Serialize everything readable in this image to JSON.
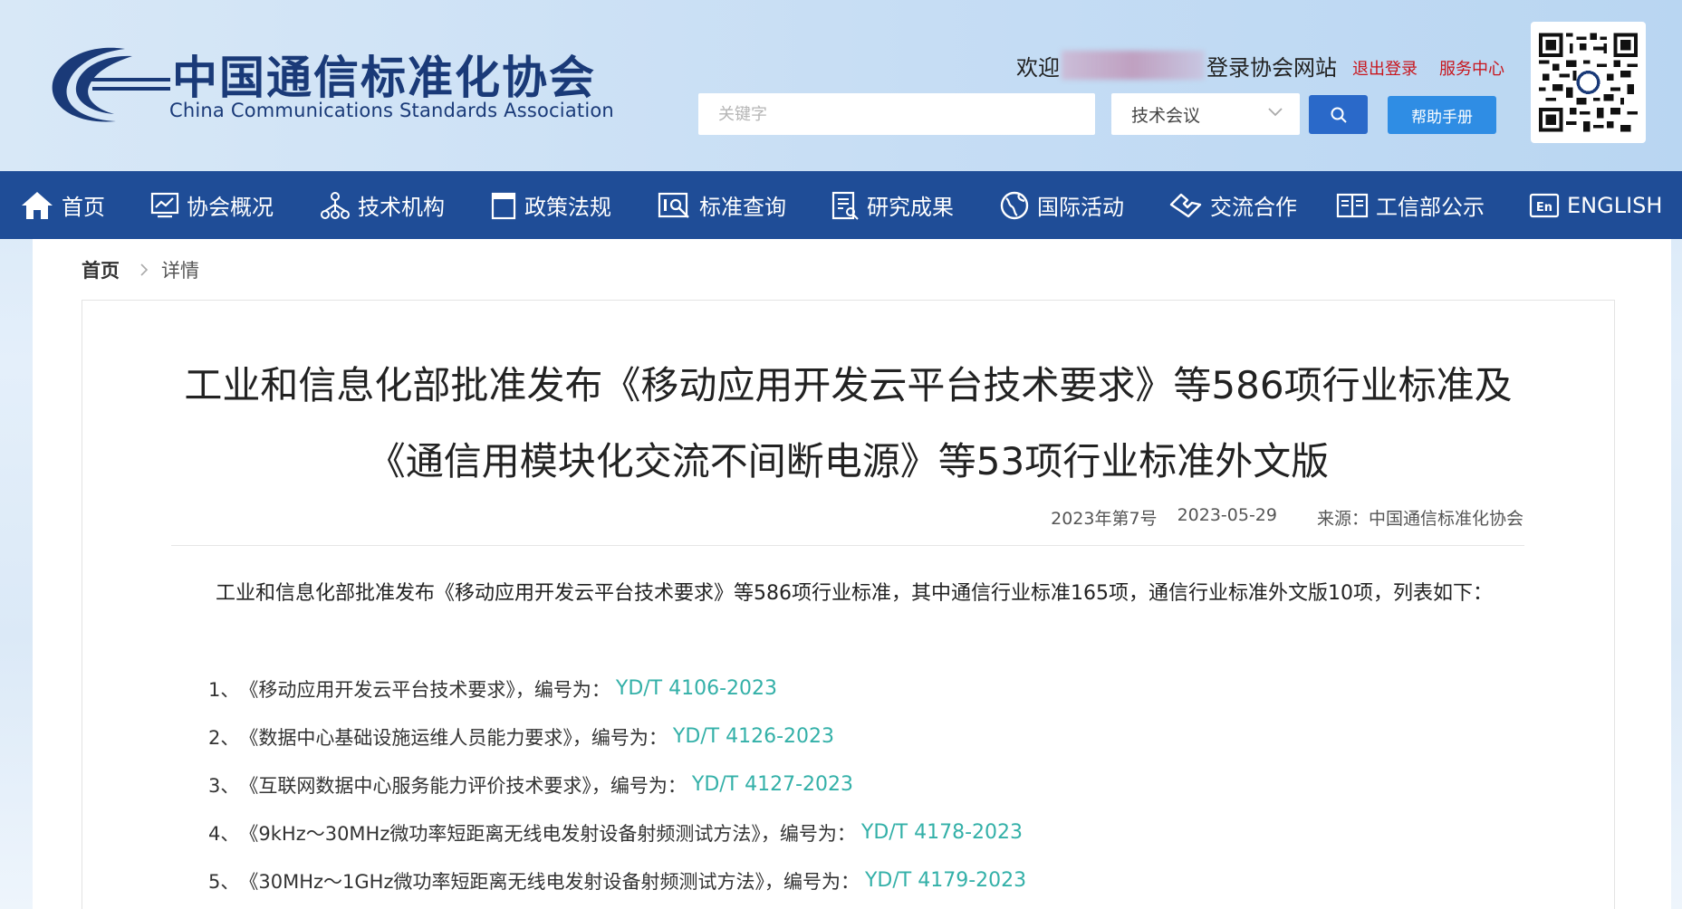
{
  "header": {
    "org_name_cn": "中国通信标准化协会",
    "org_name_en": "China Communications Standards Association",
    "welcome_prefix": "欢迎",
    "welcome_suffix": "登录协会网站",
    "logout_label": "退出登录",
    "service_label": "服务中心",
    "search_placeholder": "关键字",
    "search_category": "技术会议",
    "help_label": "帮助手册"
  },
  "nav": {
    "items": [
      {
        "label": "首页",
        "icon": "home-icon"
      },
      {
        "label": "协会概况",
        "icon": "chart-icon"
      },
      {
        "label": "技术机构",
        "icon": "org-icon"
      },
      {
        "label": "政策法规",
        "icon": "document-icon"
      },
      {
        "label": "标准查询",
        "icon": "search-doc-icon"
      },
      {
        "label": "研究成果",
        "icon": "report-icon"
      },
      {
        "label": "国际活动",
        "icon": "globe-icon"
      },
      {
        "label": "交流合作",
        "icon": "handshake-icon"
      },
      {
        "label": "工信部公示",
        "icon": "book-icon"
      },
      {
        "label": "ENGLISH",
        "icon": "english-icon"
      }
    ]
  },
  "breadcrumb": {
    "home": "首页",
    "current": "详情"
  },
  "article": {
    "title_line1": "工业和信息化部批准发布《移动应用开发云平台技术要求》等586项行业标准及",
    "title_line2": "《通信用模块化交流不间断电源》等53项行业标准外文版",
    "issue": "2023年第7号",
    "date": "2023-05-29",
    "source": "来源：中国通信标准化协会",
    "intro": "工业和信息化部批准发布《移动应用开发云平台技术要求》等586项行业标准，其中通信行业标准165项，通信行业标准外文版10项，列表如下：",
    "items": [
      {
        "index": "1、",
        "name": "《移动应用开发云平台技术要求》，编号为：",
        "code": "YD/T 4106-2023"
      },
      {
        "index": "2、",
        "name": "《数据中心基础设施运维人员能力要求》，编号为：",
        "code": "YD/T 4126-2023"
      },
      {
        "index": "3、",
        "name": "《互联网数据中心服务能力评价技术要求》，编号为：",
        "code": "YD/T 4127-2023"
      },
      {
        "index": "4、",
        "name": "《9kHz～30MHz微功率短距离无线电发射设备射频测试方法》，编号为：",
        "code": "YD/T 4178-2023"
      },
      {
        "index": "5、",
        "name": "《30MHz～1GHz微功率短距离无线电发射设备射频测试方法》，编号为：",
        "code": "YD/T 4179-2023"
      }
    ]
  },
  "colors": {
    "nav_bg": "#1f4d97",
    "brand_blue": "#1a3a78",
    "link_red": "#c8161d",
    "code_teal": "#33b0a8",
    "search_btn": "#2a69c9",
    "help_btn": "#2f8de4"
  }
}
